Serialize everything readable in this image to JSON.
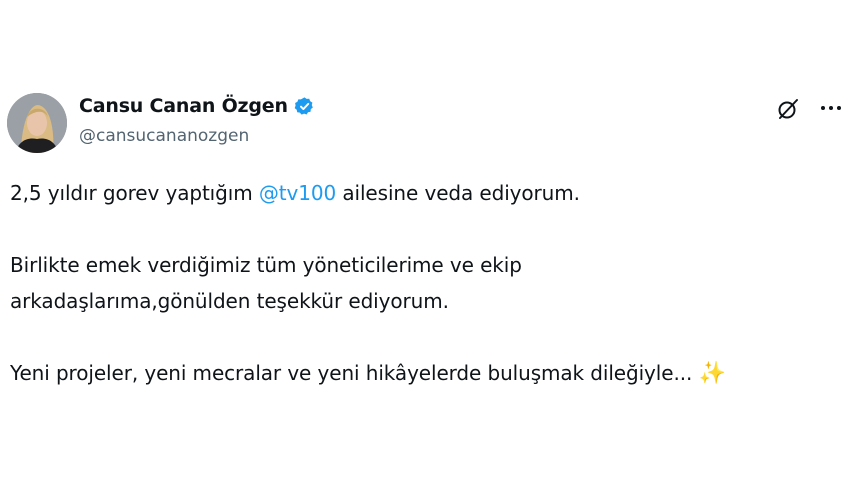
{
  "author": {
    "name": "Cansu Canan Özgen",
    "handle": "@cansucananozgen",
    "verified_icon": "verified-badge-icon",
    "avatar": "profile-photo"
  },
  "actions": {
    "grok_icon": "grok-slash-icon",
    "more_icon": "more-horizontal-icon"
  },
  "tweet": {
    "line1_pre": "2,5 yıldır gorev yaptığım ",
    "mention": "@tv100",
    "line1_post": " ailesine veda ediyorum.",
    "para2_line1": "Birlikte emek verdiğimiz tüm yöneticilerime ve ekip",
    "para2_line2": "arkadaşlarıma,gönülden teşekkür ediyorum.",
    "para3": "Yeni projeler, yeni mecralar ve yeni hikâyelerde buluşmak dileğiyle... ",
    "emoji": "✨"
  },
  "colors": {
    "accent": "#1d9bf0",
    "text": "#0f1419",
    "secondary": "#536471"
  }
}
